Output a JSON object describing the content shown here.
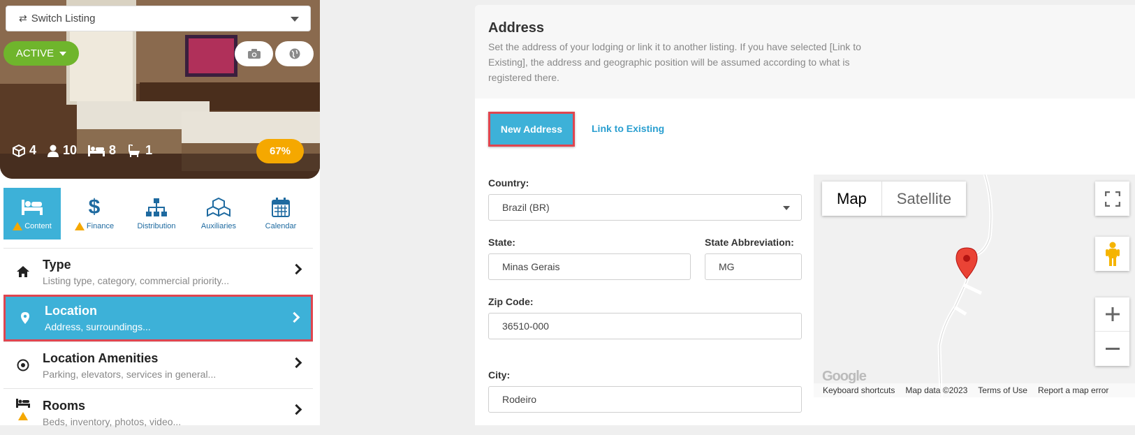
{
  "sidebar": {
    "switch_label": "Switch Listing",
    "status_label": "ACTIVE",
    "stats": {
      "units": "4",
      "guests": "10",
      "beds": "8",
      "baths": "1"
    },
    "completion": "67%",
    "tabs": [
      {
        "label": "Content",
        "icon": "bed-icon",
        "selected": true,
        "warning": true
      },
      {
        "label": "Finance",
        "icon": "dollar-icon",
        "selected": false,
        "warning": true
      },
      {
        "label": "Distribution",
        "icon": "sitemap-icon",
        "selected": false,
        "warning": false
      },
      {
        "label": "Auxiliaries",
        "icon": "cubes-icon",
        "selected": false,
        "warning": false
      },
      {
        "label": "Calendar",
        "icon": "calendar-icon",
        "selected": false,
        "warning": false
      }
    ],
    "menu": [
      {
        "title": "Type",
        "subtitle": "Listing type, category, commercial priority...",
        "icon": "home-icon"
      },
      {
        "title": "Location",
        "subtitle": "Address, surroundings...",
        "icon": "map-pin-icon",
        "selected": true
      },
      {
        "title": "Location Amenities",
        "subtitle": "Parking, elevators, services in general...",
        "icon": "target-icon"
      },
      {
        "title": "Rooms",
        "subtitle": "Beds, inventory, photos, video...",
        "icon": "bed-icon"
      }
    ]
  },
  "main": {
    "title": "Address",
    "description": "Set the address of your lodging or link it to another listing. If you have selected [Link to Existing], the address and geographic position will be assumed according to what is registered there.",
    "new_address_label": "New Address",
    "link_existing_label": "Link to Existing",
    "form": {
      "country_label": "Country:",
      "country_value": "Brazil (BR)",
      "state_label": "State:",
      "state_value": "Minas Gerais",
      "state_abbr_label": "State Abbreviation:",
      "state_abbr_value": "MG",
      "zip_label": "Zip Code:",
      "zip_value": "36510-000",
      "city_label": "City:",
      "city_value": "Rodeiro"
    },
    "map": {
      "map_label": "Map",
      "satellite_label": "Satellite",
      "google_label": "Google",
      "footer": [
        "Keyboard shortcuts",
        "Map data ©2023",
        "Terms of Use",
        "Report a map error"
      ]
    }
  },
  "colors": {
    "accent": "#3db1d8",
    "active_green": "#6fb52c",
    "completion_orange": "#f5a800",
    "highlight_red": "#e0454f"
  }
}
